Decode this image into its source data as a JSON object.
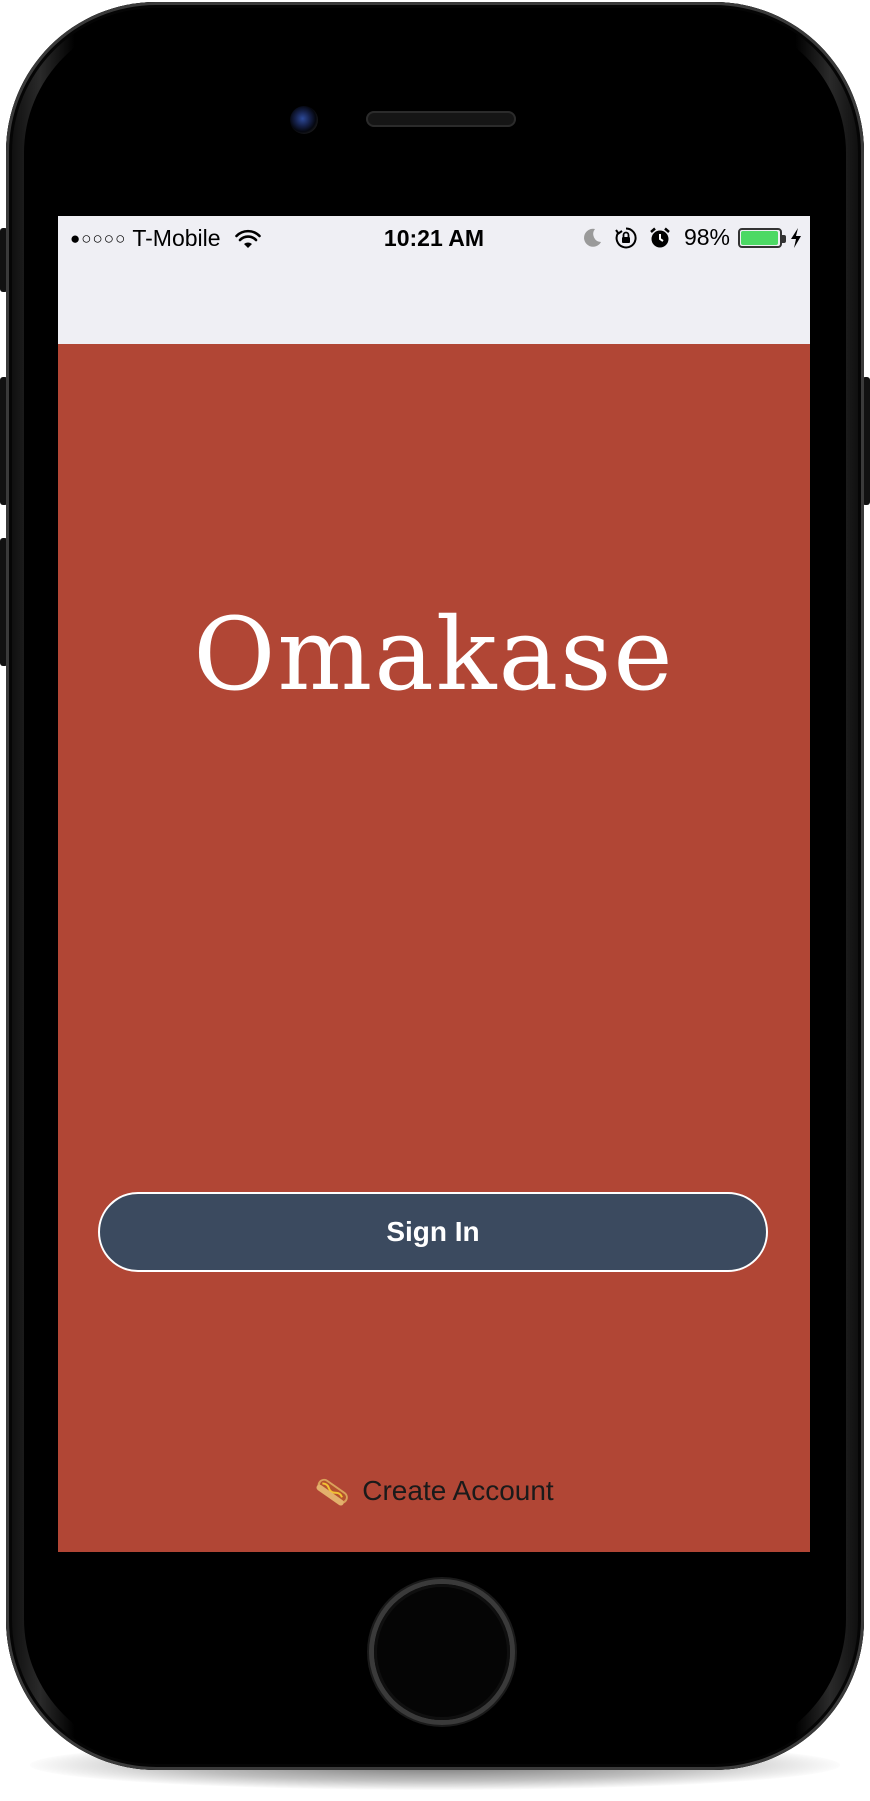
{
  "status_bar": {
    "signal": "●○○○○",
    "carrier": "T-Mobile",
    "time": "10:21 AM",
    "battery_percent": "98%",
    "battery_level": 0.98,
    "icons": [
      "wifi-icon",
      "moon-icon",
      "orientation-lock-icon",
      "alarm-icon",
      "battery-icon",
      "charging-bolt-icon"
    ]
  },
  "app": {
    "logo_text": "Omakase"
  },
  "actions": {
    "sign_in_label": "Sign In",
    "create_account_label": "Create Account",
    "create_account_icon": "hotdog-icon"
  },
  "colors": {
    "background": "#b14635",
    "nav_background": "#efeff4",
    "button_background": "#3b4a5f",
    "button_text": "#ffffff",
    "battery_fill": "#4cd964"
  }
}
